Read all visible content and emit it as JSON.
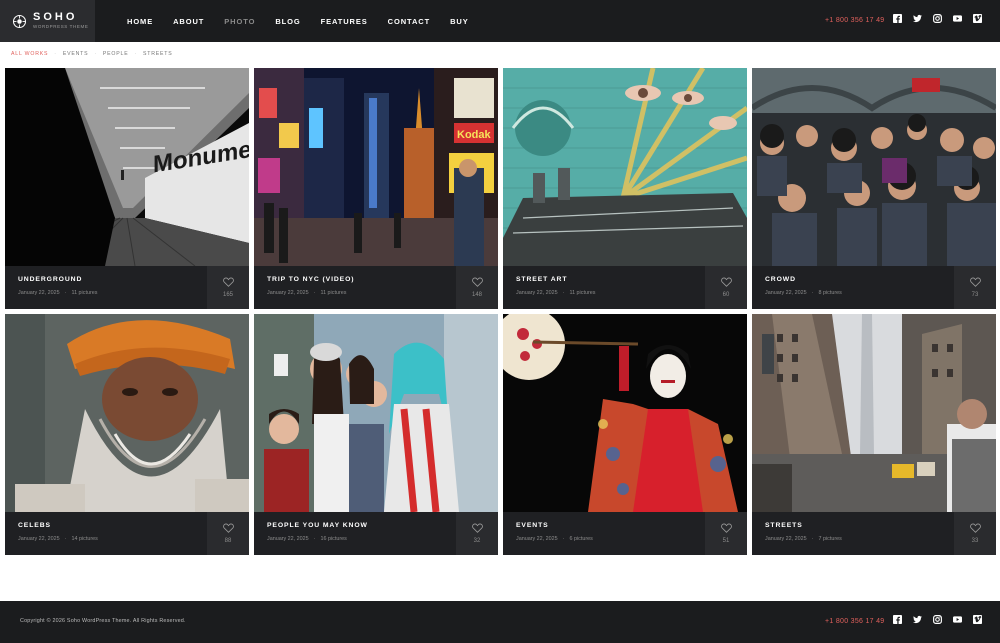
{
  "brand": {
    "name": "SOHO",
    "tagline": "WORDPRESS THEME"
  },
  "nav": [
    {
      "label": "HOME",
      "active": false
    },
    {
      "label": "ABOUT",
      "active": false
    },
    {
      "label": "PHOTO",
      "active": true
    },
    {
      "label": "BLOG",
      "active": false
    },
    {
      "label": "FEATURES",
      "active": false
    },
    {
      "label": "CONTACT",
      "active": false
    },
    {
      "label": "BUY",
      "active": false
    }
  ],
  "phone": "+1 800 356 17 49",
  "socials": [
    "facebook-icon",
    "twitter-icon",
    "instagram-icon",
    "youtube-icon",
    "vimeo-icon"
  ],
  "filters": [
    {
      "label": "ALL WORKS",
      "active": true
    },
    {
      "label": "EVENTS",
      "active": false
    },
    {
      "label": "PEOPLE",
      "active": false
    },
    {
      "label": "STREETS",
      "active": false
    }
  ],
  "cards": [
    {
      "title": "UNDERGROUND",
      "date": "January 22, 2025",
      "pictures": "11 pictures",
      "likes": "165",
      "scene": "tunnel-photo"
    },
    {
      "title": "TRIP TO NYC (VIDEO)",
      "date": "January 22, 2025",
      "pictures": "11 pictures",
      "likes": "148",
      "scene": "times-square-photo"
    },
    {
      "title": "STREET ART",
      "date": "January 22, 2025",
      "pictures": "11 pictures",
      "likes": "60",
      "scene": "mural-photo"
    },
    {
      "title": "CROWD",
      "date": "January 22, 2025",
      "pictures": "8 pictures",
      "likes": "73",
      "scene": "crowd-photo"
    },
    {
      "title": "CELEBS",
      "date": "January 22, 2025",
      "pictures": "14 pictures",
      "likes": "88",
      "scene": "bearded-man-photo"
    },
    {
      "title": "PEOPLE YOU MAY KNOW",
      "date": "January 22, 2025",
      "pictures": "16 pictures",
      "likes": "32",
      "scene": "cosplay-girls-photo"
    },
    {
      "title": "EVENTS",
      "date": "January 22, 2025",
      "pictures": "6 pictures",
      "likes": "51",
      "scene": "geisha-photo"
    },
    {
      "title": "STREETS",
      "date": "January 22, 2025",
      "pictures": "7 pictures",
      "likes": "33",
      "scene": "city-street-photo"
    }
  ],
  "footer": {
    "copyright": "Copyright © 2026 Soho WordPress Theme. All Rights Reserved.",
    "phone": "+1 800 356 17 49"
  },
  "colors": {
    "accent": "#e0605c",
    "topbar": "#1b1c1e",
    "card": "#1f2023"
  }
}
